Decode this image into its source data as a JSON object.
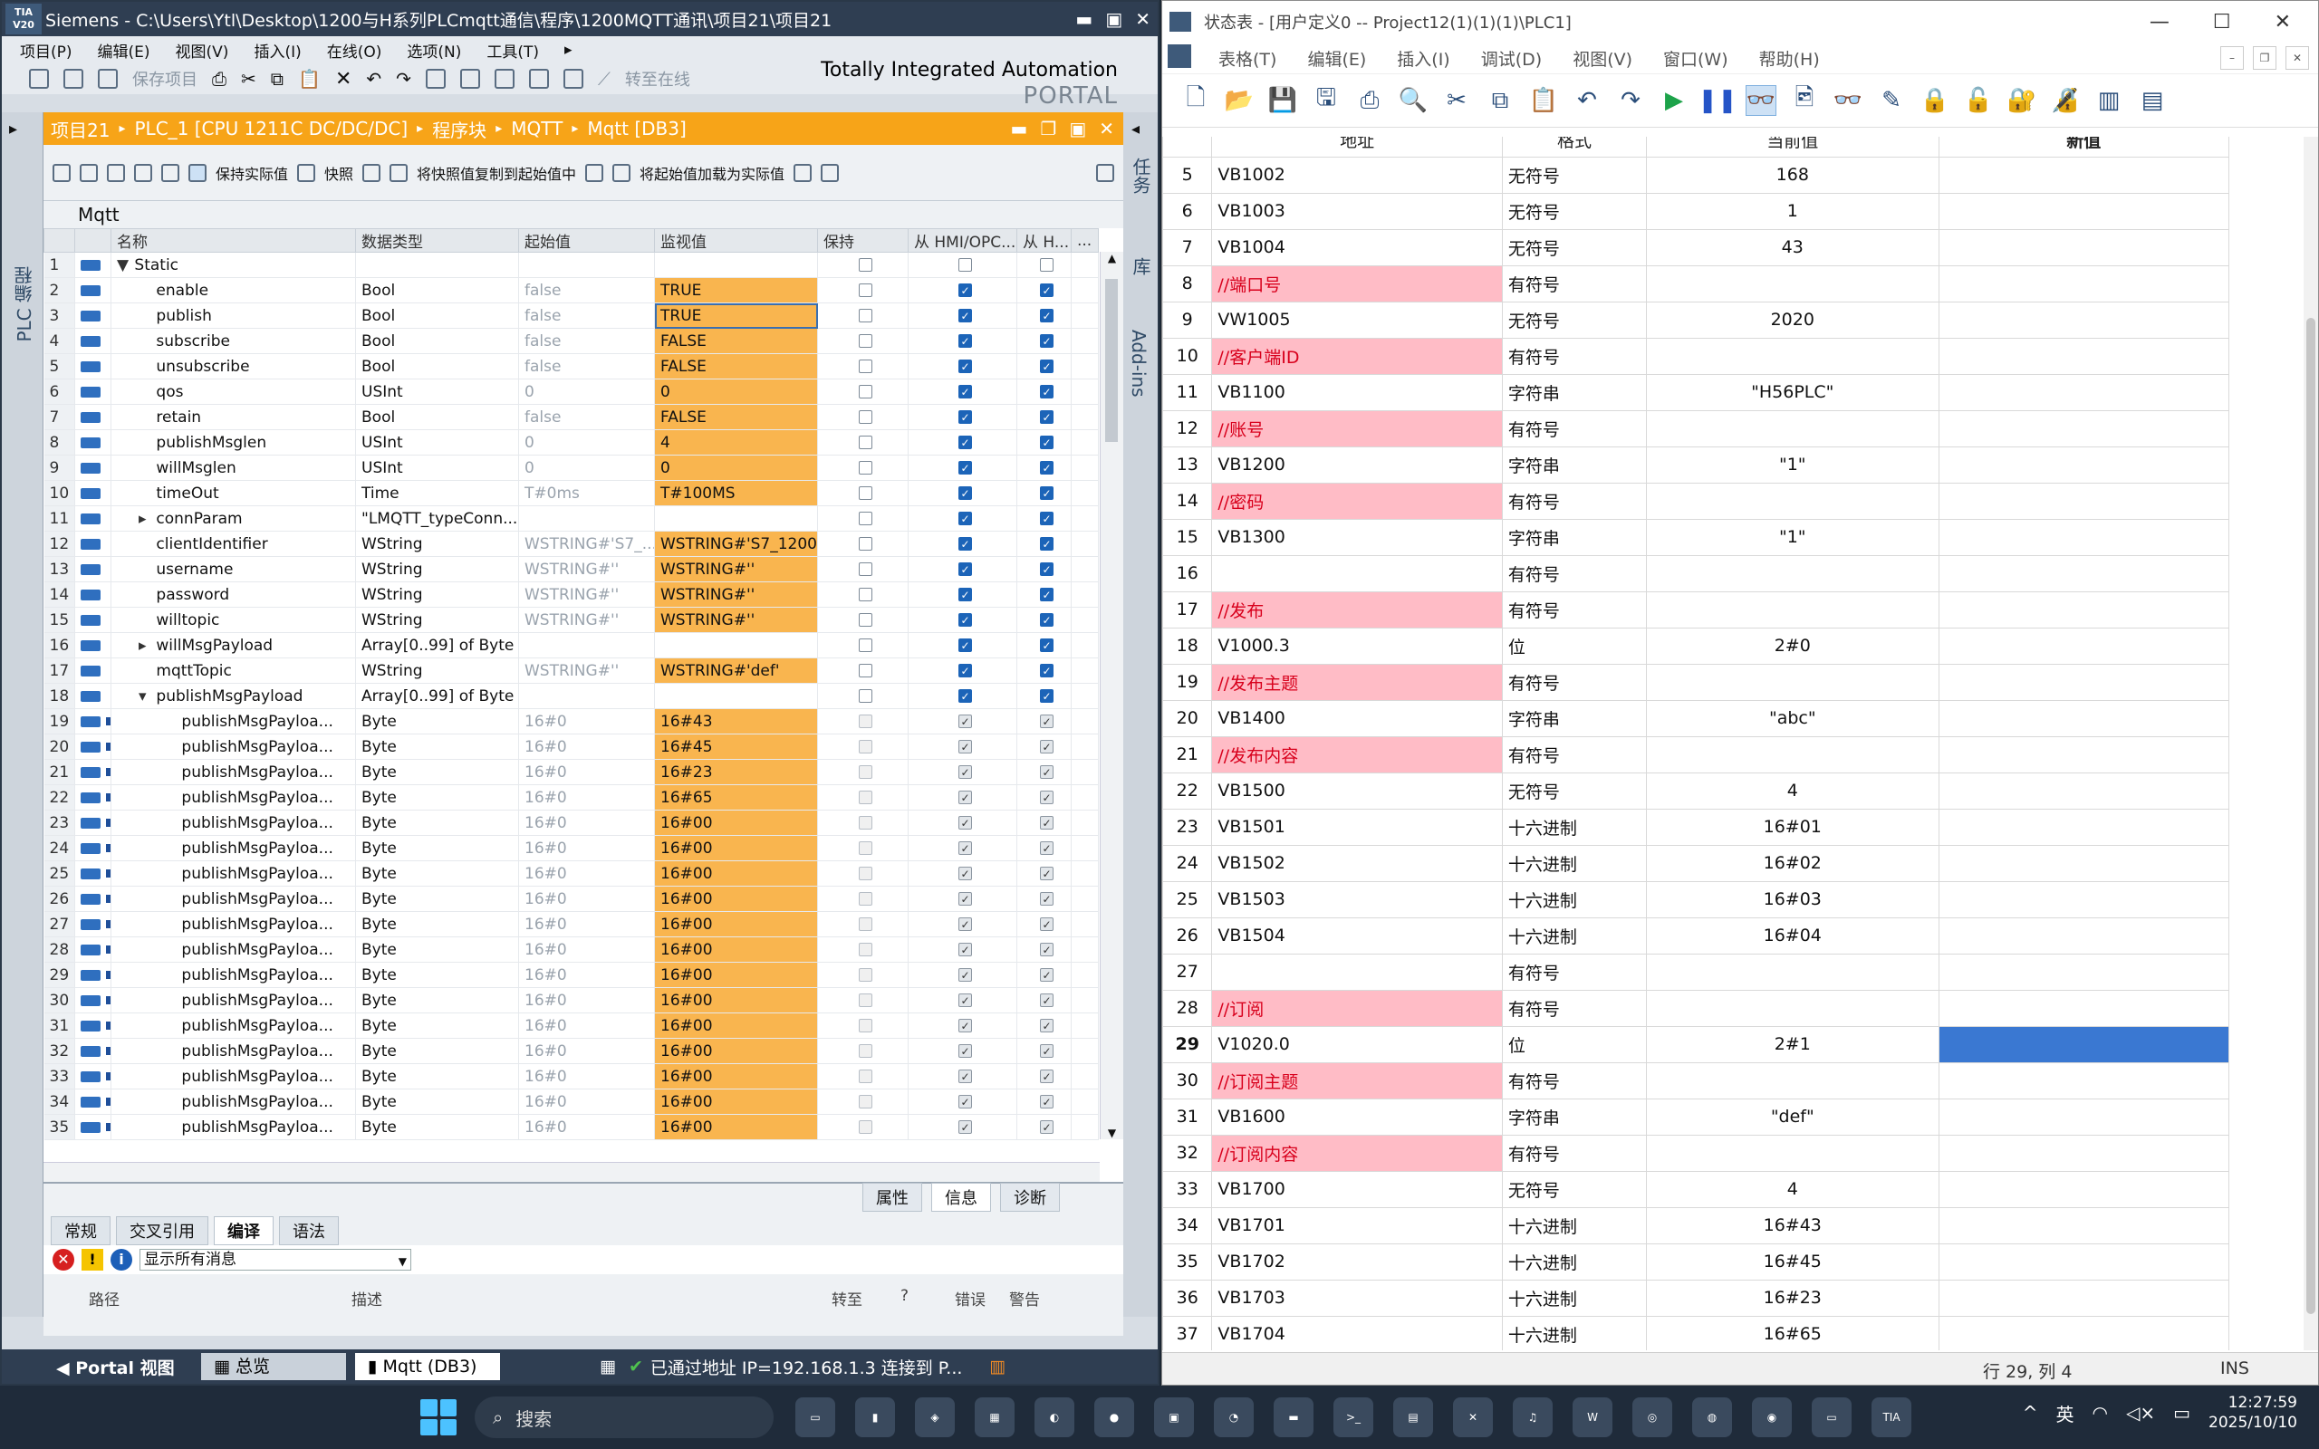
{
  "tia": {
    "logo": "TIA V20",
    "title": "Siemens   -  C:\\Users\\Ytl\\Desktop\\1200与H系列PLCmqtt通信\\程序\\1200MQTT通讯\\项目21\\项目21",
    "menus": [
      "项目(P)",
      "编辑(E)",
      "视图(V)",
      "插入(I)",
      "在线(O)",
      "选项(N)",
      "工具(T)"
    ],
    "toolbar": {
      "save": "保存项目",
      "online": "转至在线"
    },
    "brand1": "Totally Integrated Automation",
    "brand2": "PORTAL",
    "left_vertical": "PLC 编程",
    "right_tabs": [
      "任务",
      "库",
      "Add-ins"
    ],
    "breadcrumb": [
      "项目21",
      "PLC_1 [CPU 1211C DC/DC/DC]",
      "程序块",
      "MQTT",
      "Mqtt [DB3]"
    ],
    "db_toolbar": {
      "keep_actual": "保持实际值",
      "snapshot": "快照",
      "copy_snapshot": "将快照值复制到起始值中",
      "load_start": "将起始值加载为实际值"
    },
    "db_name": "Mqtt",
    "columns": [
      "名称",
      "数据类型",
      "起始值",
      "监视值",
      "保持",
      "从 HMI/OPC...",
      "从 H...",
      "..."
    ],
    "rows": [
      {
        "n": "1",
        "exp": "▼",
        "name": "Static",
        "type": "",
        "start": "",
        "mon": "",
        "k": false,
        "a": false,
        "b": false,
        "lvl": 0,
        "ic": "big"
      },
      {
        "n": "2",
        "exp": "",
        "name": "enable",
        "type": "Bool",
        "start": "false",
        "mon": "TRUE",
        "k": false,
        "a": true,
        "b": true,
        "lvl": 1,
        "ic": "big"
      },
      {
        "n": "3",
        "exp": "",
        "name": "publish",
        "type": "Bool",
        "start": "false",
        "mon": "TRUE",
        "k": false,
        "a": true,
        "b": true,
        "lvl": 1,
        "ic": "big"
      },
      {
        "n": "4",
        "exp": "",
        "name": "subscribe",
        "type": "Bool",
        "start": "false",
        "mon": "FALSE",
        "k": false,
        "a": true,
        "b": true,
        "lvl": 1,
        "ic": "big"
      },
      {
        "n": "5",
        "exp": "",
        "name": "unsubscribe",
        "type": "Bool",
        "start": "false",
        "mon": "FALSE",
        "k": false,
        "a": true,
        "b": true,
        "lvl": 1,
        "ic": "big"
      },
      {
        "n": "6",
        "exp": "",
        "name": "qos",
        "type": "USInt",
        "start": "0",
        "mon": "0",
        "k": false,
        "a": true,
        "b": true,
        "lvl": 1,
        "ic": "big"
      },
      {
        "n": "7",
        "exp": "",
        "name": "retain",
        "type": "Bool",
        "start": "false",
        "mon": "FALSE",
        "k": false,
        "a": true,
        "b": true,
        "lvl": 1,
        "ic": "big"
      },
      {
        "n": "8",
        "exp": "",
        "name": "publishMsglen",
        "type": "USInt",
        "start": "0",
        "mon": "4",
        "k": false,
        "a": true,
        "b": true,
        "lvl": 1,
        "ic": "big"
      },
      {
        "n": "9",
        "exp": "",
        "name": "willMsglen",
        "type": "USInt",
        "start": "0",
        "mon": "0",
        "k": false,
        "a": true,
        "b": true,
        "lvl": 1,
        "ic": "big"
      },
      {
        "n": "10",
        "exp": "",
        "name": "timeOut",
        "type": "Time",
        "start": "T#0ms",
        "mon": "T#100MS",
        "k": false,
        "a": true,
        "b": true,
        "lvl": 1,
        "ic": "big"
      },
      {
        "n": "11",
        "exp": "▸",
        "name": "connParam",
        "type": "\"LMQTT_typeConn...",
        "start": "",
        "mon": "",
        "k": false,
        "a": true,
        "b": true,
        "lvl": 1,
        "ic": "big"
      },
      {
        "n": "12",
        "exp": "",
        "name": "clientIdentifier",
        "type": "WString",
        "start": "WSTRING#'S7_...",
        "mon": "WSTRING#'S7_1200'",
        "k": false,
        "a": true,
        "b": true,
        "lvl": 1,
        "ic": "big"
      },
      {
        "n": "13",
        "exp": "",
        "name": "username",
        "type": "WString",
        "start": "WSTRING#''",
        "mon": "WSTRING#''",
        "k": false,
        "a": true,
        "b": true,
        "lvl": 1,
        "ic": "big"
      },
      {
        "n": "14",
        "exp": "",
        "name": "password",
        "type": "WString",
        "start": "WSTRING#''",
        "mon": "WSTRING#''",
        "k": false,
        "a": true,
        "b": true,
        "lvl": 1,
        "ic": "big"
      },
      {
        "n": "15",
        "exp": "",
        "name": "willtopic",
        "type": "WString",
        "start": "WSTRING#''",
        "mon": "WSTRING#''",
        "k": false,
        "a": true,
        "b": true,
        "lvl": 1,
        "ic": "big"
      },
      {
        "n": "16",
        "exp": "▸",
        "name": "willMsgPayload",
        "type": "Array[0..99] of Byte",
        "start": "",
        "mon": "",
        "k": false,
        "a": true,
        "b": true,
        "lvl": 1,
        "ic": "big"
      },
      {
        "n": "17",
        "exp": "",
        "name": "mqttTopic",
        "type": "WString",
        "start": "WSTRING#''",
        "mon": "WSTRING#'def'",
        "k": false,
        "a": true,
        "b": true,
        "lvl": 1,
        "ic": "big"
      },
      {
        "n": "18",
        "exp": "▾",
        "name": "publishMsgPayload",
        "type": "Array[0..99] of Byte",
        "start": "",
        "mon": "",
        "k": false,
        "a": true,
        "b": true,
        "lvl": 1,
        "ic": "big"
      },
      {
        "n": "19",
        "exp": "",
        "name": "publishMsgPayloa...",
        "type": "Byte",
        "start": "16#0",
        "mon": "16#43",
        "k": false,
        "a": true,
        "b": true,
        "lvl": 2,
        "ic": "sm"
      },
      {
        "n": "20",
        "exp": "",
        "name": "publishMsgPayloa...",
        "type": "Byte",
        "start": "16#0",
        "mon": "16#45",
        "k": false,
        "a": true,
        "b": true,
        "lvl": 2,
        "ic": "sm"
      },
      {
        "n": "21",
        "exp": "",
        "name": "publishMsgPayloa...",
        "type": "Byte",
        "start": "16#0",
        "mon": "16#23",
        "k": false,
        "a": true,
        "b": true,
        "lvl": 2,
        "ic": "sm"
      },
      {
        "n": "22",
        "exp": "",
        "name": "publishMsgPayloa...",
        "type": "Byte",
        "start": "16#0",
        "mon": "16#65",
        "k": false,
        "a": true,
        "b": true,
        "lvl": 2,
        "ic": "sm"
      },
      {
        "n": "23",
        "exp": "",
        "name": "publishMsgPayloa...",
        "type": "Byte",
        "start": "16#0",
        "mon": "16#00",
        "k": false,
        "a": true,
        "b": true,
        "lvl": 2,
        "ic": "sm"
      },
      {
        "n": "24",
        "exp": "",
        "name": "publishMsgPayloa...",
        "type": "Byte",
        "start": "16#0",
        "mon": "16#00",
        "k": false,
        "a": true,
        "b": true,
        "lvl": 2,
        "ic": "sm"
      },
      {
        "n": "25",
        "exp": "",
        "name": "publishMsgPayloa...",
        "type": "Byte",
        "start": "16#0",
        "mon": "16#00",
        "k": false,
        "a": true,
        "b": true,
        "lvl": 2,
        "ic": "sm"
      },
      {
        "n": "26",
        "exp": "",
        "name": "publishMsgPayloa...",
        "type": "Byte",
        "start": "16#0",
        "mon": "16#00",
        "k": false,
        "a": true,
        "b": true,
        "lvl": 2,
        "ic": "sm"
      },
      {
        "n": "27",
        "exp": "",
        "name": "publishMsgPayloa...",
        "type": "Byte",
        "start": "16#0",
        "mon": "16#00",
        "k": false,
        "a": true,
        "b": true,
        "lvl": 2,
        "ic": "sm"
      },
      {
        "n": "28",
        "exp": "",
        "name": "publishMsgPayloa...",
        "type": "Byte",
        "start": "16#0",
        "mon": "16#00",
        "k": false,
        "a": true,
        "b": true,
        "lvl": 2,
        "ic": "sm"
      },
      {
        "n": "29",
        "exp": "",
        "name": "publishMsgPayloa...",
        "type": "Byte",
        "start": "16#0",
        "mon": "16#00",
        "k": false,
        "a": true,
        "b": true,
        "lvl": 2,
        "ic": "sm"
      },
      {
        "n": "30",
        "exp": "",
        "name": "publishMsgPayloa...",
        "type": "Byte",
        "start": "16#0",
        "mon": "16#00",
        "k": false,
        "a": true,
        "b": true,
        "lvl": 2,
        "ic": "sm"
      },
      {
        "n": "31",
        "exp": "",
        "name": "publishMsgPayloa...",
        "type": "Byte",
        "start": "16#0",
        "mon": "16#00",
        "k": false,
        "a": true,
        "b": true,
        "lvl": 2,
        "ic": "sm"
      },
      {
        "n": "32",
        "exp": "",
        "name": "publishMsgPayloa...",
        "type": "Byte",
        "start": "16#0",
        "mon": "16#00",
        "k": false,
        "a": true,
        "b": true,
        "lvl": 2,
        "ic": "sm"
      },
      {
        "n": "33",
        "exp": "",
        "name": "publishMsgPayloa...",
        "type": "Byte",
        "start": "16#0",
        "mon": "16#00",
        "k": false,
        "a": true,
        "b": true,
        "lvl": 2,
        "ic": "sm"
      },
      {
        "n": "34",
        "exp": "",
        "name": "publishMsgPayloa...",
        "type": "Byte",
        "start": "16#0",
        "mon": "16#00",
        "k": false,
        "a": true,
        "b": true,
        "lvl": 2,
        "ic": "sm"
      },
      {
        "n": "35",
        "exp": "",
        "name": "publishMsgPayloa...",
        "type": "Byte",
        "start": "16#0",
        "mon": "16#00",
        "k": false,
        "a": true,
        "b": true,
        "lvl": 2,
        "ic": "sm"
      }
    ],
    "inspector_tabs": [
      "属性",
      "信息",
      "诊断"
    ],
    "info_tabs": [
      "常规",
      "交叉引用",
      "编译",
      "语法"
    ],
    "filter_option": "显示所有消息",
    "msg_columns": [
      "路径",
      "描述",
      "转至",
      "?",
      "错误",
      "警告"
    ],
    "portal_view": "Portal 视图",
    "status_tabs": [
      "总览",
      "Mqtt (DB3)"
    ],
    "status_msg": "已通过地址 IP=192.168.1.3 连接到 P..."
  },
  "vt": {
    "title": "状态表 - [用户定义0 -- Project12(1)(1)(1)\\PLC1]",
    "menus": [
      "表格(T)",
      "编辑(E)",
      "插入(I)",
      "调试(D)",
      "视图(V)",
      "窗口(W)",
      "帮助(H)"
    ],
    "columns": [
      "地址",
      "格式",
      "当前值",
      "新值"
    ],
    "rows": [
      {
        "n": "5",
        "addr": "VB1002",
        "fmt": "无符号",
        "val": "168",
        "cmt": false
      },
      {
        "n": "6",
        "addr": "VB1003",
        "fmt": "无符号",
        "val": "1",
        "cmt": false
      },
      {
        "n": "7",
        "addr": "VB1004",
        "fmt": "无符号",
        "val": "43",
        "cmt": false
      },
      {
        "n": "8",
        "addr": "//端口号",
        "fmt": "有符号",
        "val": "",
        "cmt": true
      },
      {
        "n": "9",
        "addr": "VW1005",
        "fmt": "无符号",
        "val": "2020",
        "cmt": false
      },
      {
        "n": "10",
        "addr": "//客户端ID",
        "fmt": "有符号",
        "val": "",
        "cmt": true
      },
      {
        "n": "11",
        "addr": "VB1100",
        "fmt": "字符串",
        "val": "\"H56PLC\"",
        "cmt": false
      },
      {
        "n": "12",
        "addr": "//账号",
        "fmt": "有符号",
        "val": "",
        "cmt": true
      },
      {
        "n": "13",
        "addr": "VB1200",
        "fmt": "字符串",
        "val": "\"1\"",
        "cmt": false
      },
      {
        "n": "14",
        "addr": "//密码",
        "fmt": "有符号",
        "val": "",
        "cmt": true
      },
      {
        "n": "15",
        "addr": "VB1300",
        "fmt": "字符串",
        "val": "\"1\"",
        "cmt": false
      },
      {
        "n": "16",
        "addr": "",
        "fmt": "有符号",
        "val": "",
        "cmt": false
      },
      {
        "n": "17",
        "addr": "//发布",
        "fmt": "有符号",
        "val": "",
        "cmt": true
      },
      {
        "n": "18",
        "addr": "V1000.3",
        "fmt": "位",
        "val": "2#0",
        "cmt": false
      },
      {
        "n": "19",
        "addr": "//发布主题",
        "fmt": "有符号",
        "val": "",
        "cmt": true
      },
      {
        "n": "20",
        "addr": "VB1400",
        "fmt": "字符串",
        "val": "\"abc\"",
        "cmt": false
      },
      {
        "n": "21",
        "addr": "//发布内容",
        "fmt": "有符号",
        "val": "",
        "cmt": true
      },
      {
        "n": "22",
        "addr": "VB1500",
        "fmt": "无符号",
        "val": "4",
        "cmt": false
      },
      {
        "n": "23",
        "addr": "VB1501",
        "fmt": "十六进制",
        "val": "16#01",
        "cmt": false
      },
      {
        "n": "24",
        "addr": "VB1502",
        "fmt": "十六进制",
        "val": "16#02",
        "cmt": false
      },
      {
        "n": "25",
        "addr": "VB1503",
        "fmt": "十六进制",
        "val": "16#03",
        "cmt": false
      },
      {
        "n": "26",
        "addr": "VB1504",
        "fmt": "十六进制",
        "val": "16#04",
        "cmt": false
      },
      {
        "n": "27",
        "addr": "",
        "fmt": "有符号",
        "val": "",
        "cmt": false
      },
      {
        "n": "28",
        "addr": "//订阅",
        "fmt": "有符号",
        "val": "",
        "cmt": true
      },
      {
        "n": "29",
        "addr": "V1020.0",
        "fmt": "位",
        "val": "2#1",
        "cmt": false,
        "cur": true
      },
      {
        "n": "30",
        "addr": "//订阅主题",
        "fmt": "有符号",
        "val": "",
        "cmt": true
      },
      {
        "n": "31",
        "addr": "VB1600",
        "fmt": "字符串",
        "val": "\"def\"",
        "cmt": false
      },
      {
        "n": "32",
        "addr": "//订阅内容",
        "fmt": "有符号",
        "val": "",
        "cmt": true
      },
      {
        "n": "33",
        "addr": "VB1700",
        "fmt": "无符号",
        "val": "4",
        "cmt": false
      },
      {
        "n": "34",
        "addr": "VB1701",
        "fmt": "十六进制",
        "val": "16#43",
        "cmt": false
      },
      {
        "n": "35",
        "addr": "VB1702",
        "fmt": "十六进制",
        "val": "16#45",
        "cmt": false
      },
      {
        "n": "36",
        "addr": "VB1703",
        "fmt": "十六进制",
        "val": "16#23",
        "cmt": false
      },
      {
        "n": "37",
        "addr": "VB1704",
        "fmt": "十六进制",
        "val": "16#65",
        "cmt": false
      }
    ],
    "status_pos": "行 29, 列 4",
    "status_mode": "INS"
  },
  "taskbar": {
    "search": "搜索",
    "ime": "英",
    "time": "12:27:59",
    "date": "2025/10/10"
  },
  "colors": {
    "orange": "#f7a418",
    "monitor": "#f9b54f",
    "comment_bg": "#ffbcc6",
    "comment_text": "#d8001c",
    "selected": "#3a78d2"
  }
}
